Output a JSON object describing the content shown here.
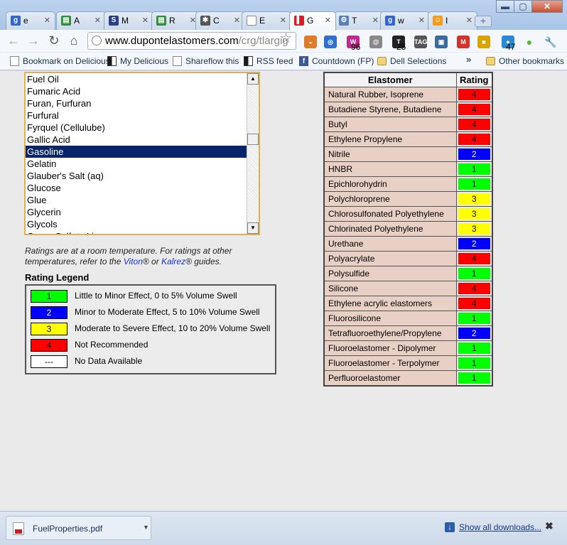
{
  "tabs": [
    {
      "label": "e",
      "icon": "google-icon",
      "color": "#3366cc",
      "glyph": "g"
    },
    {
      "label": "A",
      "icon": "green-doc-icon",
      "color": "#2f8f3a",
      "glyph": "▤"
    },
    {
      "label": "M",
      "icon": "ste-icon",
      "color": "#2b3e88",
      "glyph": "S"
    },
    {
      "label": "R",
      "icon": "green-doc-icon",
      "color": "#2f8f3a",
      "glyph": "▤"
    },
    {
      "label": "C",
      "icon": "puzzle-icon",
      "color": "#555555",
      "glyph": "✱"
    },
    {
      "label": "E",
      "icon": "blank-page-icon",
      "color": "#ffffff",
      "glyph": ""
    },
    {
      "label": "G",
      "icon": "dupont-icon",
      "color": "#d21f26",
      "glyph": "▌"
    },
    {
      "label": "T",
      "icon": "gear-icon",
      "color": "#5a7fb8",
      "glyph": "⚙"
    },
    {
      "label": "w",
      "icon": "google-icon",
      "color": "#3366cc",
      "glyph": "g"
    },
    {
      "label": "I",
      "icon": "person-icon",
      "color": "#f29d1f",
      "glyph": "☺"
    }
  ],
  "address": {
    "domain": "www.dupontelastomers.com",
    "path": "/crg/tlargig"
  },
  "bookmarks": {
    "items": [
      "Bookmark on Delicious",
      "My Delicious",
      "Shareflow this",
      "RSS feed",
      "Countdown (FP)",
      "Dell Selections"
    ],
    "overflow": "»",
    "other": "Other bookmarks"
  },
  "extensions": [
    {
      "name": "basket-icon",
      "color": "#e07b2a",
      "glyph": "◒",
      "badge": ""
    },
    {
      "name": "globe-icon",
      "color": "#2f6fd0",
      "glyph": "◎",
      "badge": ""
    },
    {
      "name": "w-icon",
      "color": "#c02a8c",
      "glyph": "W",
      "badge": "96"
    },
    {
      "name": "at-icon",
      "color": "#888888",
      "glyph": "@",
      "badge": ""
    },
    {
      "name": "nyt-icon",
      "color": "#222222",
      "glyph": "T",
      "badge": "25"
    },
    {
      "name": "tag-icon",
      "color": "#555555",
      "glyph": "TAG",
      "badge": ""
    },
    {
      "name": "picture-icon",
      "color": "#3a6b9c",
      "glyph": "▣",
      "badge": ""
    },
    {
      "name": "gmail-icon",
      "color": "#d4322a",
      "glyph": "M",
      "badge": ""
    },
    {
      "name": "notebook-icon",
      "color": "#d9a400",
      "glyph": "■",
      "badge": ""
    },
    {
      "name": "counter-icon",
      "color": "#2a8bd4",
      "glyph": "●",
      "badge": "47"
    },
    {
      "name": "status-dot-icon",
      "color": "#58b82f",
      "glyph": "●",
      "badge": ""
    },
    {
      "name": "wrench-icon",
      "color": "#777777",
      "glyph": "🔧",
      "badge": ""
    }
  ],
  "chemical_list": {
    "items": [
      "Fuel Oil",
      "Fumaric Acid",
      "Furan, Furfuran",
      "Furfural",
      "Fyrquel (Cellulube)",
      "Gallic Acid",
      "Gasoline",
      "Gelatin",
      "Glauber's Salt (aq)",
      "Glucose",
      "Glue",
      "Glycerin",
      "Glycols",
      "Green Sulfate Liquor"
    ],
    "selected": "Gasoline"
  },
  "note": {
    "prefix": "Ratings are at a room temperature. For ratings at other temperatures, refer to the ",
    "viton": "Viton",
    "reg1": "® or ",
    "kalrez": "Kalrez",
    "suffix": "® guides."
  },
  "legend": {
    "title": "Rating Legend",
    "items": [
      {
        "label": "1",
        "text": "Little to Minor Effect, 0 to 5% Volume Swell",
        "color": "#00ff00",
        "text_color": "#000000"
      },
      {
        "label": "2",
        "text": "Minor to Moderate Effect, 5 to 10% Volume Swell",
        "color": "#0000ff",
        "text_color": "#ffffff"
      },
      {
        "label": "3",
        "text": "Moderate to Severe Effect, 10 to 20% Volume Swell",
        "color": "#ffff00",
        "text_color": "#000000"
      },
      {
        "label": "4",
        "text": "Not Recommended",
        "color": "#ff0000",
        "text_color": "#000000"
      },
      {
        "label": "---",
        "text": "No Data Available",
        "color": "#ffffff",
        "text_color": "#000000"
      }
    ]
  },
  "ratings": {
    "headers": [
      "Elastomer",
      "Rating"
    ],
    "rows": [
      {
        "name": "Natural Rubber, Isoprene",
        "rating": "4"
      },
      {
        "name": "Butadiene Styrene, Butadiene",
        "rating": "4"
      },
      {
        "name": "Butyl",
        "rating": "4"
      },
      {
        "name": "Ethylene Propylene",
        "rating": "4"
      },
      {
        "name": "Nitrile",
        "rating": "2"
      },
      {
        "name": "HNBR",
        "rating": "1"
      },
      {
        "name": "Epichlorohydrin",
        "rating": "1"
      },
      {
        "name": "Polychloroprene",
        "rating": "3"
      },
      {
        "name": "Chlorosulfonated Polyethylene",
        "rating": "3"
      },
      {
        "name": "Chlorinated Polyethylene",
        "rating": "3"
      },
      {
        "name": "Urethane",
        "rating": "2"
      },
      {
        "name": "Polyacrylate",
        "rating": "4"
      },
      {
        "name": "Polysulfide",
        "rating": "1"
      },
      {
        "name": "Silicone",
        "rating": "4"
      },
      {
        "name": "Ethylene acrylic elastomers",
        "rating": "4"
      },
      {
        "name": "Fluorosilicone",
        "rating": "1"
      },
      {
        "name": "Tetrafluoroethylene/Propylene",
        "rating": "2"
      },
      {
        "name": "Fluoroelastomer - Dipolymer",
        "rating": "1"
      },
      {
        "name": "Fluoroelastomer - Terpolymer",
        "rating": "1"
      },
      {
        "name": "Perfluoroelastomer",
        "rating": "1"
      }
    ]
  },
  "downloads": {
    "file": "FuelProperties.pdf",
    "show_all": "Show all downloads...",
    "close": "✖"
  },
  "window": {
    "minimize": "▬",
    "maximize": "▢",
    "close": "✕"
  }
}
